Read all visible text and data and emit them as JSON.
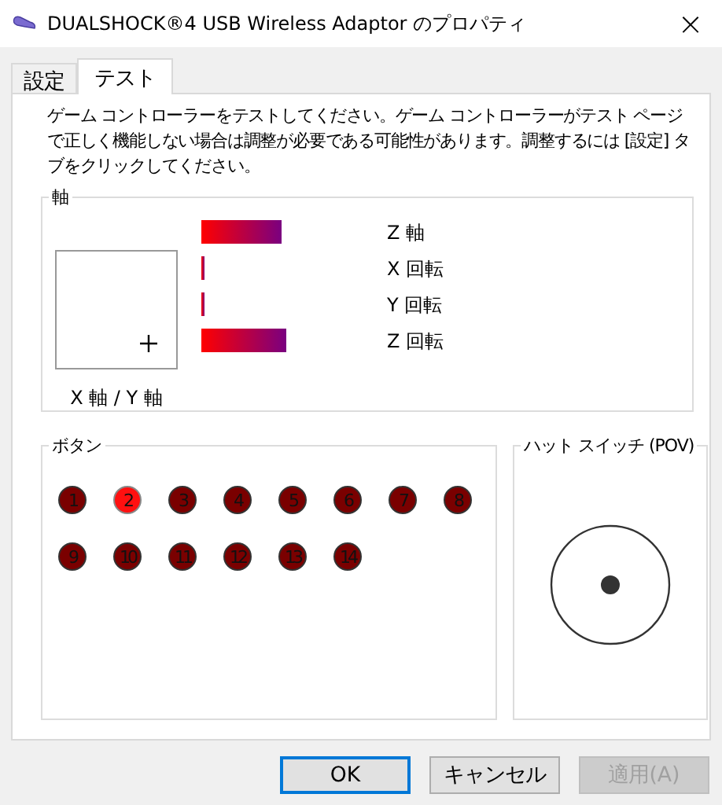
{
  "window": {
    "title": "DUALSHOCK®4 USB Wireless Adaptor のプロパティ",
    "close": "×"
  },
  "tabs": [
    {
      "label": "設定",
      "selected": false
    },
    {
      "label": "テスト",
      "selected": true
    }
  ],
  "description": "ゲーム コントローラーをテストしてください。ゲーム コントローラーがテスト ページで正しく機能しない場合は調整が必要である可能性があります。調整するには [設定] タブをクリックしてください。",
  "axes": {
    "title": "軸",
    "xy_label": "X 軸 / Y 軸",
    "bars": [
      {
        "label": "Z 軸"
      },
      {
        "label": "X 回転"
      },
      {
        "label": "Y 回転"
      },
      {
        "label": "Z 回転"
      }
    ]
  },
  "buttons_group": {
    "title": "ボタン",
    "buttons": [
      {
        "label": "1",
        "pressed": false
      },
      {
        "label": "2",
        "pressed": true
      },
      {
        "label": "3",
        "pressed": false
      },
      {
        "label": "4",
        "pressed": false
      },
      {
        "label": "5",
        "pressed": false
      },
      {
        "label": "6",
        "pressed": false
      },
      {
        "label": "7",
        "pressed": false
      },
      {
        "label": "8",
        "pressed": false
      },
      {
        "label": "9",
        "pressed": false
      },
      {
        "label": "10",
        "pressed": false
      },
      {
        "label": "11",
        "pressed": false
      },
      {
        "label": "12",
        "pressed": false
      },
      {
        "label": "13",
        "pressed": false
      },
      {
        "label": "14",
        "pressed": false
      }
    ]
  },
  "hat_switch": {
    "title": "ハット スイッチ (POV)"
  },
  "footer_buttons": [
    {
      "label": "OK",
      "default": true,
      "disabled": false
    },
    {
      "label": "キャンセル",
      "default": false,
      "disabled": false
    },
    {
      "label": "適用(A)",
      "default": false,
      "disabled": true
    }
  ]
}
